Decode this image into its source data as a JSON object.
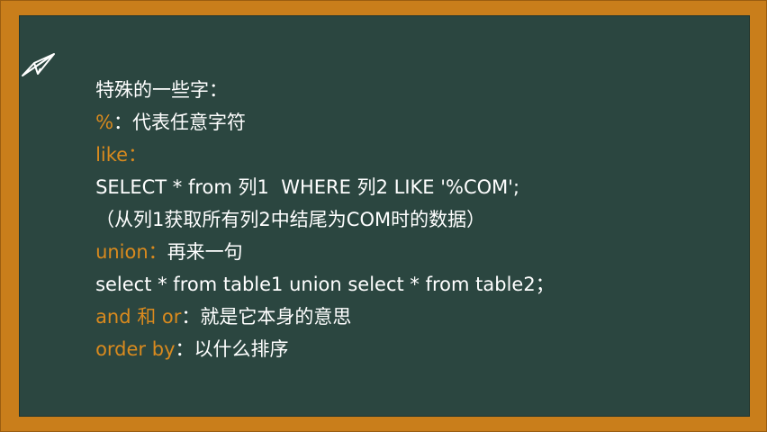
{
  "slide": {
    "heading": "特殊的一些字：",
    "percent_key": "%",
    "percent_desc": "：代表任意字符",
    "like_key": "like：",
    "like_example": "SELECT * from 列1  WHERE 列2 LIKE '%COM';",
    "like_note": "（从列1获取所有列2中结尾为COM时的数据）",
    "union_key": "union：",
    "union_desc": "再来一句",
    "union_example": "select * from table1 union select * from table2；",
    "andor_key": "and 和 or",
    "andor_desc": "：就是它本身的意思",
    "orderby_key": "order by",
    "orderby_desc": "：以什么排序"
  },
  "colors": {
    "frame": "#c97e1b",
    "board": "#2b4640",
    "keyword": "#d98a1e",
    "text": "#ffffff"
  },
  "icons": {
    "bullet": "paper-plane-icon"
  }
}
